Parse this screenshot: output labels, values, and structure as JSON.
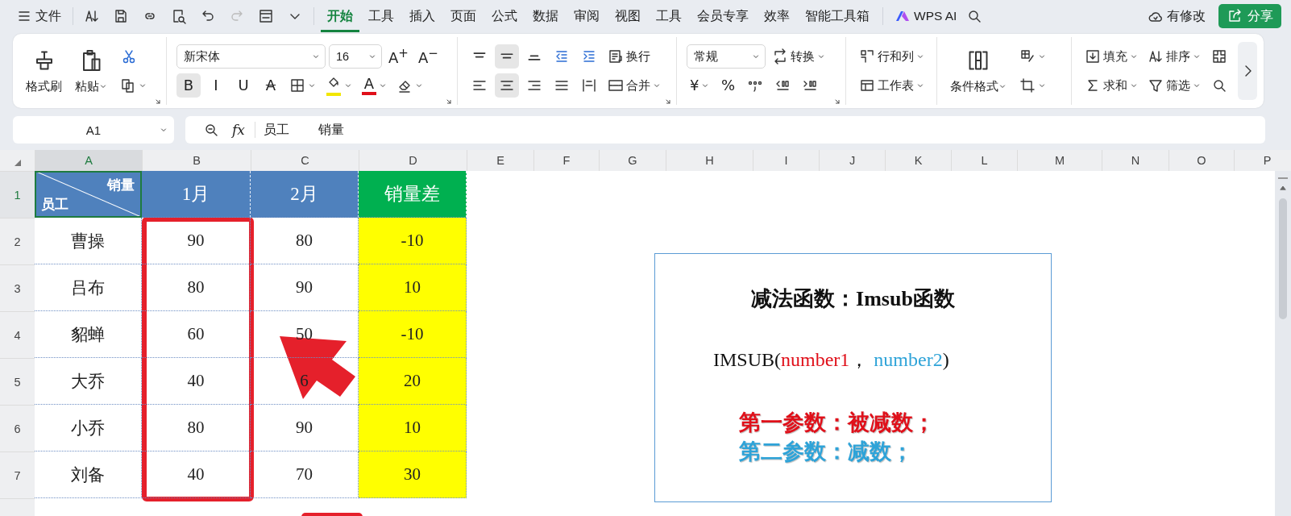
{
  "topbar": {
    "file_menu": "文件",
    "quick_access": [
      {
        "disabled": false
      },
      {
        "disabled": false
      },
      {
        "disabled": false
      },
      {
        "disabled": false
      },
      {
        "disabled": false
      },
      {
        "disabled": true
      },
      {
        "disabled": false
      },
      {
        "disabled": false
      }
    ],
    "tabs": [
      {
        "label": "开始",
        "selected": true
      },
      {
        "label": "工具",
        "selected": false
      },
      {
        "label": "插入",
        "selected": false
      },
      {
        "label": "页面",
        "selected": false
      },
      {
        "label": "公式",
        "selected": false
      },
      {
        "label": "数据",
        "selected": false
      },
      {
        "label": "审阅",
        "selected": false
      },
      {
        "label": "视图",
        "selected": false
      },
      {
        "label": "工具",
        "selected": false
      },
      {
        "label": "会员专享",
        "selected": false
      },
      {
        "label": "效率",
        "selected": false
      },
      {
        "label": "智能工具箱",
        "selected": false
      }
    ],
    "ai_button": "WPS AI",
    "save_status": "有修改",
    "share_button": "分享"
  },
  "ribbon": {
    "groups": [
      {
        "launcher": true,
        "large": [
          {
            "kind": "large",
            "label": "格式刷"
          },
          {
            "kind": "large",
            "label": "粘贴",
            "caret": true
          }
        ],
        "top": [
          {
            "kind": "button"
          }
        ],
        "bottom": [
          {
            "kind": "button",
            "caret": true
          }
        ]
      },
      {
        "launcher": true,
        "top": [
          {
            "kind": "field",
            "label": "新宋体"
          },
          {
            "kind": "field",
            "label": "16"
          },
          {
            "kind": "glyph",
            "label": "A$^{+}$"
          },
          {
            "kind": "glyph",
            "label": "A$^{−}$"
          }
        ],
        "bottom": [
          {
            "kind": "glyph",
            "label": "B",
            "selected": true
          },
          {
            "kind": "glyph",
            "label": "I",
            "selected": false
          },
          {
            "kind": "glyph",
            "label": "U",
            "selected": false
          },
          {
            "kind": "strike",
            "label": "A",
            "selected": false
          },
          {
            "kind": "button",
            "caret": true
          },
          {
            "kind": "button",
            "caret": true,
            "color": "#f2e600"
          },
          {
            "kind": "glyph",
            "label": "A",
            "caret": true,
            "color": "#e0101a"
          },
          {
            "kind": "button",
            "caret": true
          }
        ]
      },
      {
        "launcher": true,
        "top": [
          {
            "kind": "button",
            "selected": false
          },
          {
            "kind": "button",
            "selected": true
          },
          {
            "kind": "button",
            "selected": false
          },
          {
            "kind": "button"
          },
          {
            "kind": "button"
          },
          {
            "kind": "button",
            "label": "换行"
          }
        ],
        "bottom": [
          {
            "kind": "button",
            "selected": false
          },
          {
            "kind": "button",
            "selected": true
          },
          {
            "kind": "button",
            "selected": false
          },
          {
            "kind": "button",
            "selected": false
          },
          {
            "kind": "button",
            "selected": false
          },
          {
            "kind": "button",
            "label": "合并",
            "caret": true
          }
        ]
      },
      {
        "launcher": true,
        "top": [
          {
            "kind": "field",
            "label": "常规"
          },
          {
            "kind": "button",
            "label": "转换",
            "caret": true
          }
        ],
        "bottom": [
          {
            "kind": "glyph",
            "label": "¥",
            "caret": true
          },
          {
            "kind": "glyph",
            "label": "%"
          },
          {
            "kind": "button"
          },
          {
            "kind": "button"
          },
          {
            "kind": "button"
          }
        ]
      },
      {
        "launcher": false,
        "top": [
          {
            "kind": "button",
            "label": "行和列",
            "caret": true
          }
        ],
        "bottom": [
          {
            "kind": "button",
            "label": "工作表",
            "caret": true
          }
        ]
      },
      {
        "launcher": false,
        "large": [
          {
            "kind": "large",
            "label": "条件格式",
            "caret": true
          }
        ],
        "top": [
          {
            "kind": "button",
            "caret": true
          }
        ],
        "bottom": [
          {
            "kind": "button",
            "caret": true
          }
        ]
      },
      {
        "launcher": false,
        "top": [
          {
            "kind": "button",
            "label": "填充",
            "caret": true
          },
          {
            "kind": "button",
            "label": "排序",
            "caret": true
          },
          {
            "kind": "button"
          }
        ],
        "bottom": [
          {
            "kind": "button",
            "label": "求和",
            "caret": true
          },
          {
            "kind": "button",
            "label": "筛选",
            "caret": true
          },
          {
            "kind": "button"
          }
        ]
      }
    ]
  },
  "formula_bar": {
    "name_box": "A1",
    "fx_label": "fx",
    "content": "员工　　 销量"
  },
  "sheet": {
    "columns": [
      {
        "label": "A",
        "selected": true
      },
      {
        "label": "B",
        "selected": false
      },
      {
        "label": "C",
        "selected": false
      },
      {
        "label": "D",
        "selected": false
      },
      {
        "label": "E",
        "selected": false
      },
      {
        "label": "F",
        "selected": false
      },
      {
        "label": "G",
        "selected": false
      },
      {
        "label": "H",
        "selected": false
      },
      {
        "label": "I",
        "selected": false
      },
      {
        "label": "J",
        "selected": false
      },
      {
        "label": "K",
        "selected": false
      },
      {
        "label": "L",
        "selected": false
      },
      {
        "label": "M",
        "selected": false
      },
      {
        "label": "N",
        "selected": false
      },
      {
        "label": "O",
        "selected": false
      },
      {
        "label": "P",
        "selected": false
      }
    ],
    "rows": [
      {
        "label": "1",
        "selected": true,
        "cells": [
          {
            "kind": "diagonal",
            "top_right": "销量",
            "bottom_left": "员工",
            "color": "#4f81bd",
            "selected": true
          },
          {
            "kind": "header",
            "text": "1月",
            "color": "#4f81bd",
            "selected": false
          },
          {
            "kind": "header",
            "text": "2月",
            "color": "#4f81bd",
            "selected": false
          },
          {
            "kind": "header",
            "text": "销量差",
            "color": "#00b050",
            "selected": false
          }
        ]
      },
      {
        "label": "2",
        "selected": false,
        "cells": [
          {
            "kind": "data",
            "text": "曹操",
            "selected": false
          },
          {
            "kind": "data",
            "text": "90",
            "selected": false
          },
          {
            "kind": "data",
            "text": "80",
            "selected": false
          },
          {
            "kind": "data",
            "text": "-10",
            "color": "#ffff00",
            "selected": false
          }
        ]
      },
      {
        "label": "3",
        "selected": false,
        "cells": [
          {
            "kind": "data",
            "text": "吕布",
            "selected": false
          },
          {
            "kind": "data",
            "text": "80",
            "selected": false
          },
          {
            "kind": "data",
            "text": "90",
            "selected": false
          },
          {
            "kind": "data",
            "text": "10",
            "color": "#ffff00",
            "selected": false
          }
        ]
      },
      {
        "label": "4",
        "selected": false,
        "cells": [
          {
            "kind": "data",
            "text": "貂蝉",
            "selected": false
          },
          {
            "kind": "data",
            "text": "60",
            "selected": false
          },
          {
            "kind": "data",
            "text": "50",
            "selected": false
          },
          {
            "kind": "data",
            "text": "-10",
            "color": "#ffff00",
            "selected": false
          }
        ]
      },
      {
        "label": "5",
        "selected": false,
        "cells": [
          {
            "kind": "data",
            "text": "大乔",
            "selected": false
          },
          {
            "kind": "data",
            "text": "40",
            "selected": false
          },
          {
            "kind": "data",
            "text": "6",
            "selected": false
          },
          {
            "kind": "data",
            "text": "20",
            "color": "#ffff00",
            "selected": false
          }
        ]
      },
      {
        "label": "6",
        "selected": false,
        "cells": [
          {
            "kind": "data",
            "text": "小乔",
            "selected": false
          },
          {
            "kind": "data",
            "text": "80",
            "selected": false
          },
          {
            "kind": "data",
            "text": "90",
            "selected": false
          },
          {
            "kind": "data",
            "text": "10",
            "color": "#ffff00",
            "selected": false
          }
        ]
      },
      {
        "label": "7",
        "selected": false,
        "cells": [
          {
            "kind": "data",
            "text": "刘备",
            "selected": false
          },
          {
            "kind": "data",
            "text": "40",
            "selected": false
          },
          {
            "kind": "data",
            "text": "70",
            "selected": false
          },
          {
            "kind": "data",
            "text": "30",
            "color": "#ffff00",
            "selected": false
          }
        ]
      }
    ]
  },
  "annotations": [
    {
      "kind": "highlight-box"
    },
    {
      "kind": "arrow"
    },
    {
      "kind": "callout"
    }
  ],
  "text_box": {
    "lines": [
      {
        "kind": "title",
        "text": "减法函数：Imsub函数"
      },
      {
        "kind": "syntax",
        "segments": [
          {
            "text": "IMSUB(",
            "color": "#111111"
          },
          {
            "text": "number1",
            "color": "#e0101a"
          },
          {
            "text": "， ",
            "color": "#111111"
          },
          {
            "text": "number2",
            "color": "#2ea3d8"
          },
          {
            "text": ")",
            "color": "#111111"
          }
        ]
      },
      {
        "kind": "note",
        "text": "第一参数：被减数；",
        "color": "#e0101a"
      },
      {
        "kind": "note",
        "text": "第二参数：减数；",
        "color": "#2ea3d8"
      }
    ]
  }
}
